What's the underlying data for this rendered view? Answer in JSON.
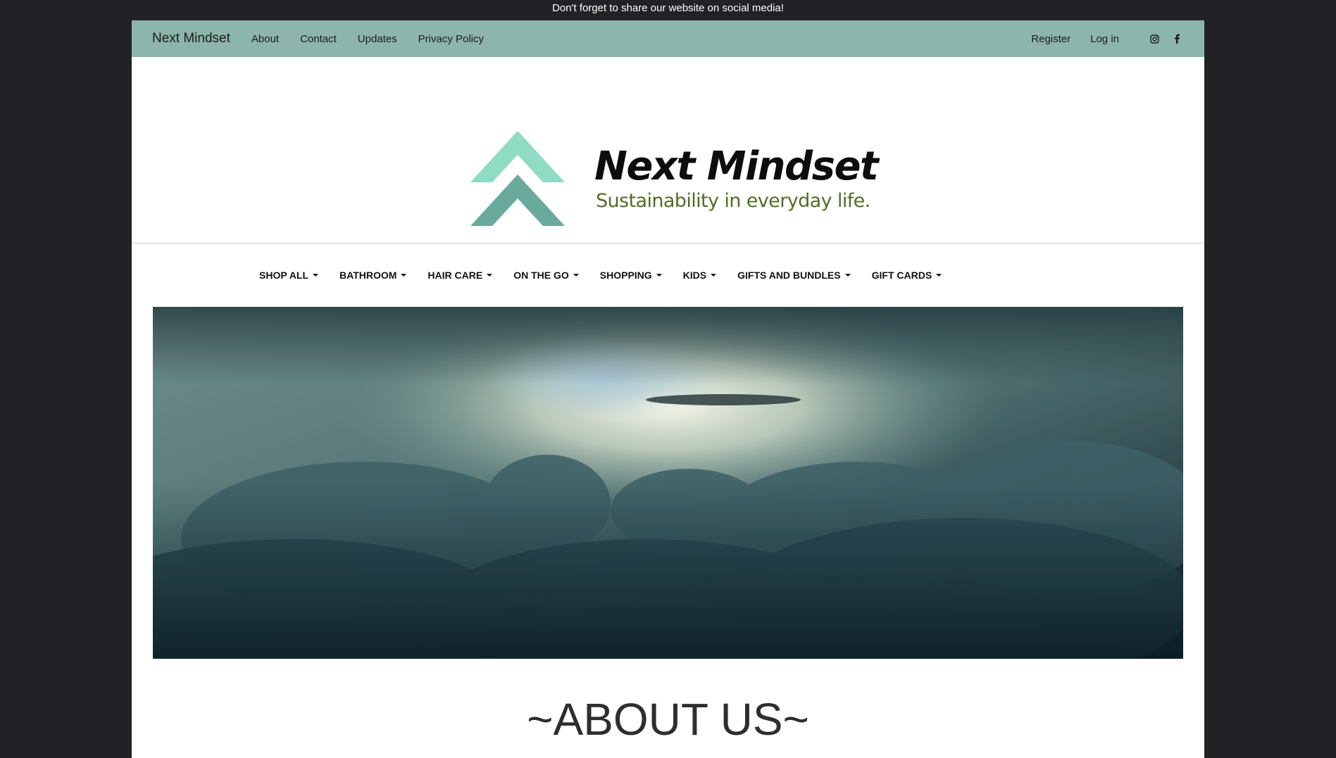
{
  "announcement": "Don't forget to share our website on social media!",
  "topbar": {
    "brand": "Next Mindset",
    "links": [
      "About",
      "Contact",
      "Updates",
      "Privacy Policy"
    ],
    "register": "Register",
    "login": "Log in",
    "social_icons": [
      "instagram-icon",
      "facebook-icon"
    ],
    "background": "#8cb5ab"
  },
  "logo": {
    "title": "Next Mindset",
    "tagline": "Sustainability in everyday life.",
    "mark_colors": [
      "#8fdcc4",
      "#6aaa9c"
    ],
    "tagline_color": "#4f6f26"
  },
  "categories": [
    "SHOP ALL",
    "BATHROOM",
    "HAIR CARE",
    "ON THE GO",
    "SHOPPING",
    "KIDS",
    "GIFTS AND BUNDLES",
    "GIFT CARDS"
  ],
  "banner": {
    "image": "clouds-sky-photo"
  },
  "about": {
    "heading": "~ABOUT US~"
  }
}
